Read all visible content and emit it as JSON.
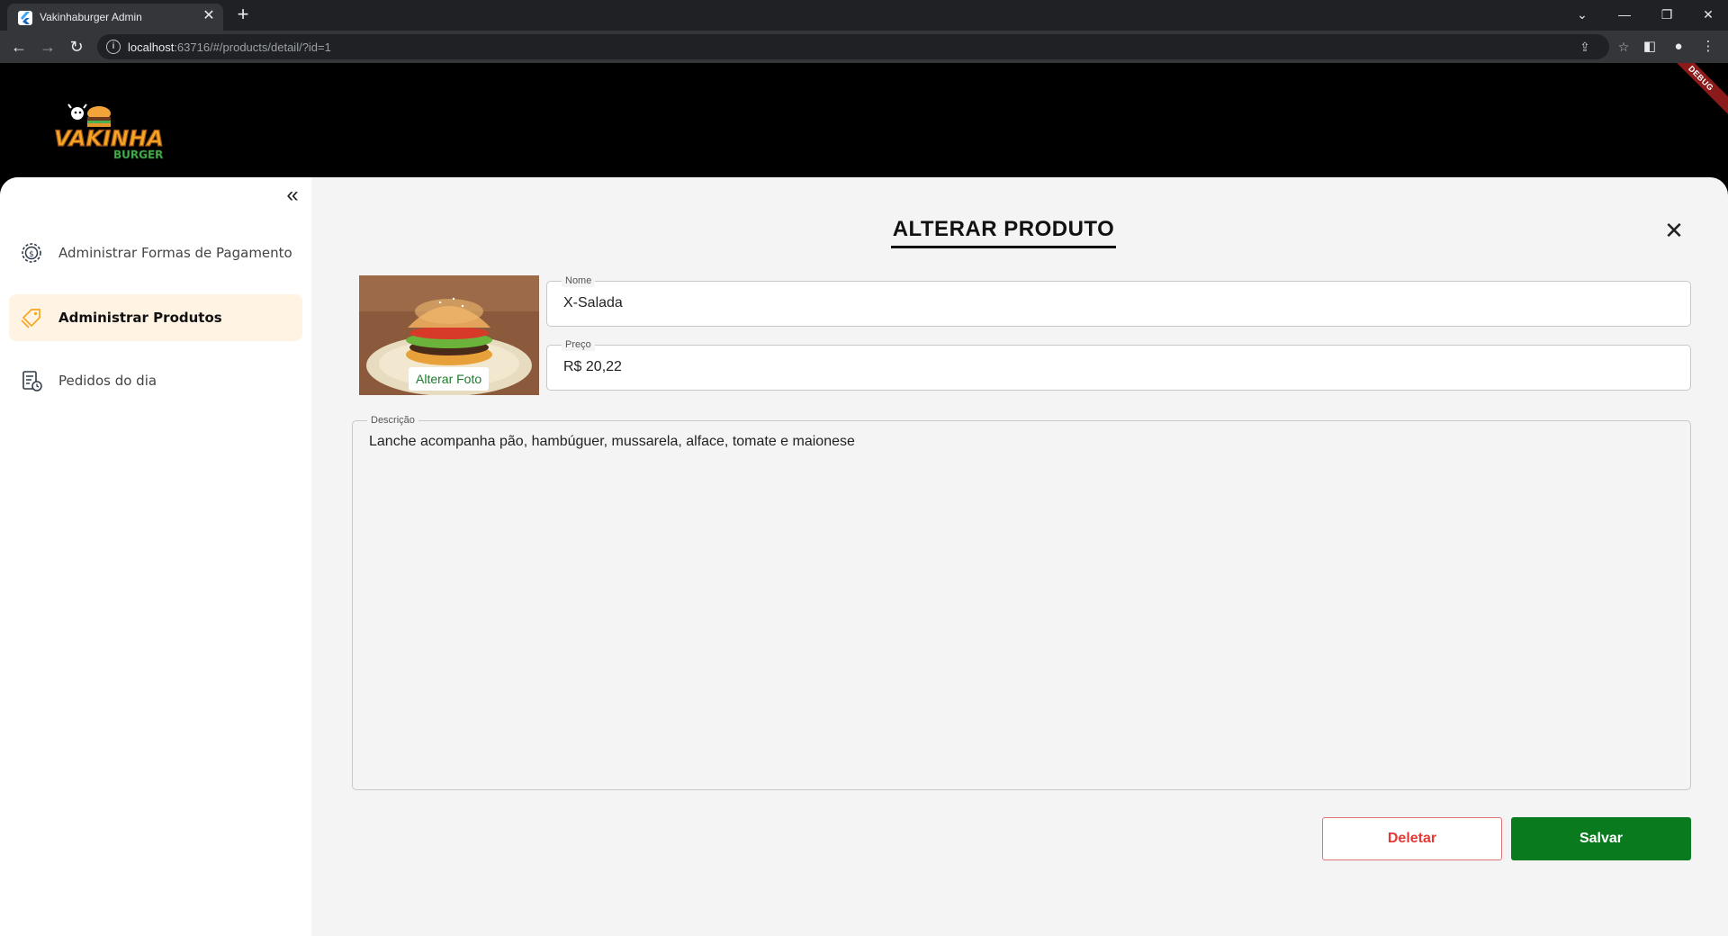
{
  "browser": {
    "tab_title": "Vakinhaburger Admin",
    "url_host": "localhost",
    "url_rest": ":63716/#/products/detail/?id=1"
  },
  "header": {
    "debug_label": "DEBUG"
  },
  "sidebar": {
    "items": [
      {
        "label": "Administrar Formas de Pagamento",
        "icon": "payment-settings-icon",
        "active": false
      },
      {
        "label": "Administrar Produtos",
        "icon": "products-tag-icon",
        "active": true
      },
      {
        "label": "Pedidos do dia",
        "icon": "orders-icon",
        "active": false
      }
    ]
  },
  "form": {
    "title": "ALTERAR PRODUTO",
    "change_photo_label": "Alterar Foto",
    "name_label": "Nome",
    "name_value": "X-Salada",
    "price_label": "Preço",
    "price_value": "R$ 20,22",
    "description_label": "Descrição",
    "description_value": "Lanche acompanha pão, hambúguer, mussarela, alface, tomate e maionese",
    "delete_label": "Deletar",
    "save_label": "Salvar"
  },
  "colors": {
    "save_button": "#0a7a1f",
    "delete_text": "#e53935",
    "active_menu_bg": "#fff4e3",
    "accent_orange": "#f5a623"
  }
}
